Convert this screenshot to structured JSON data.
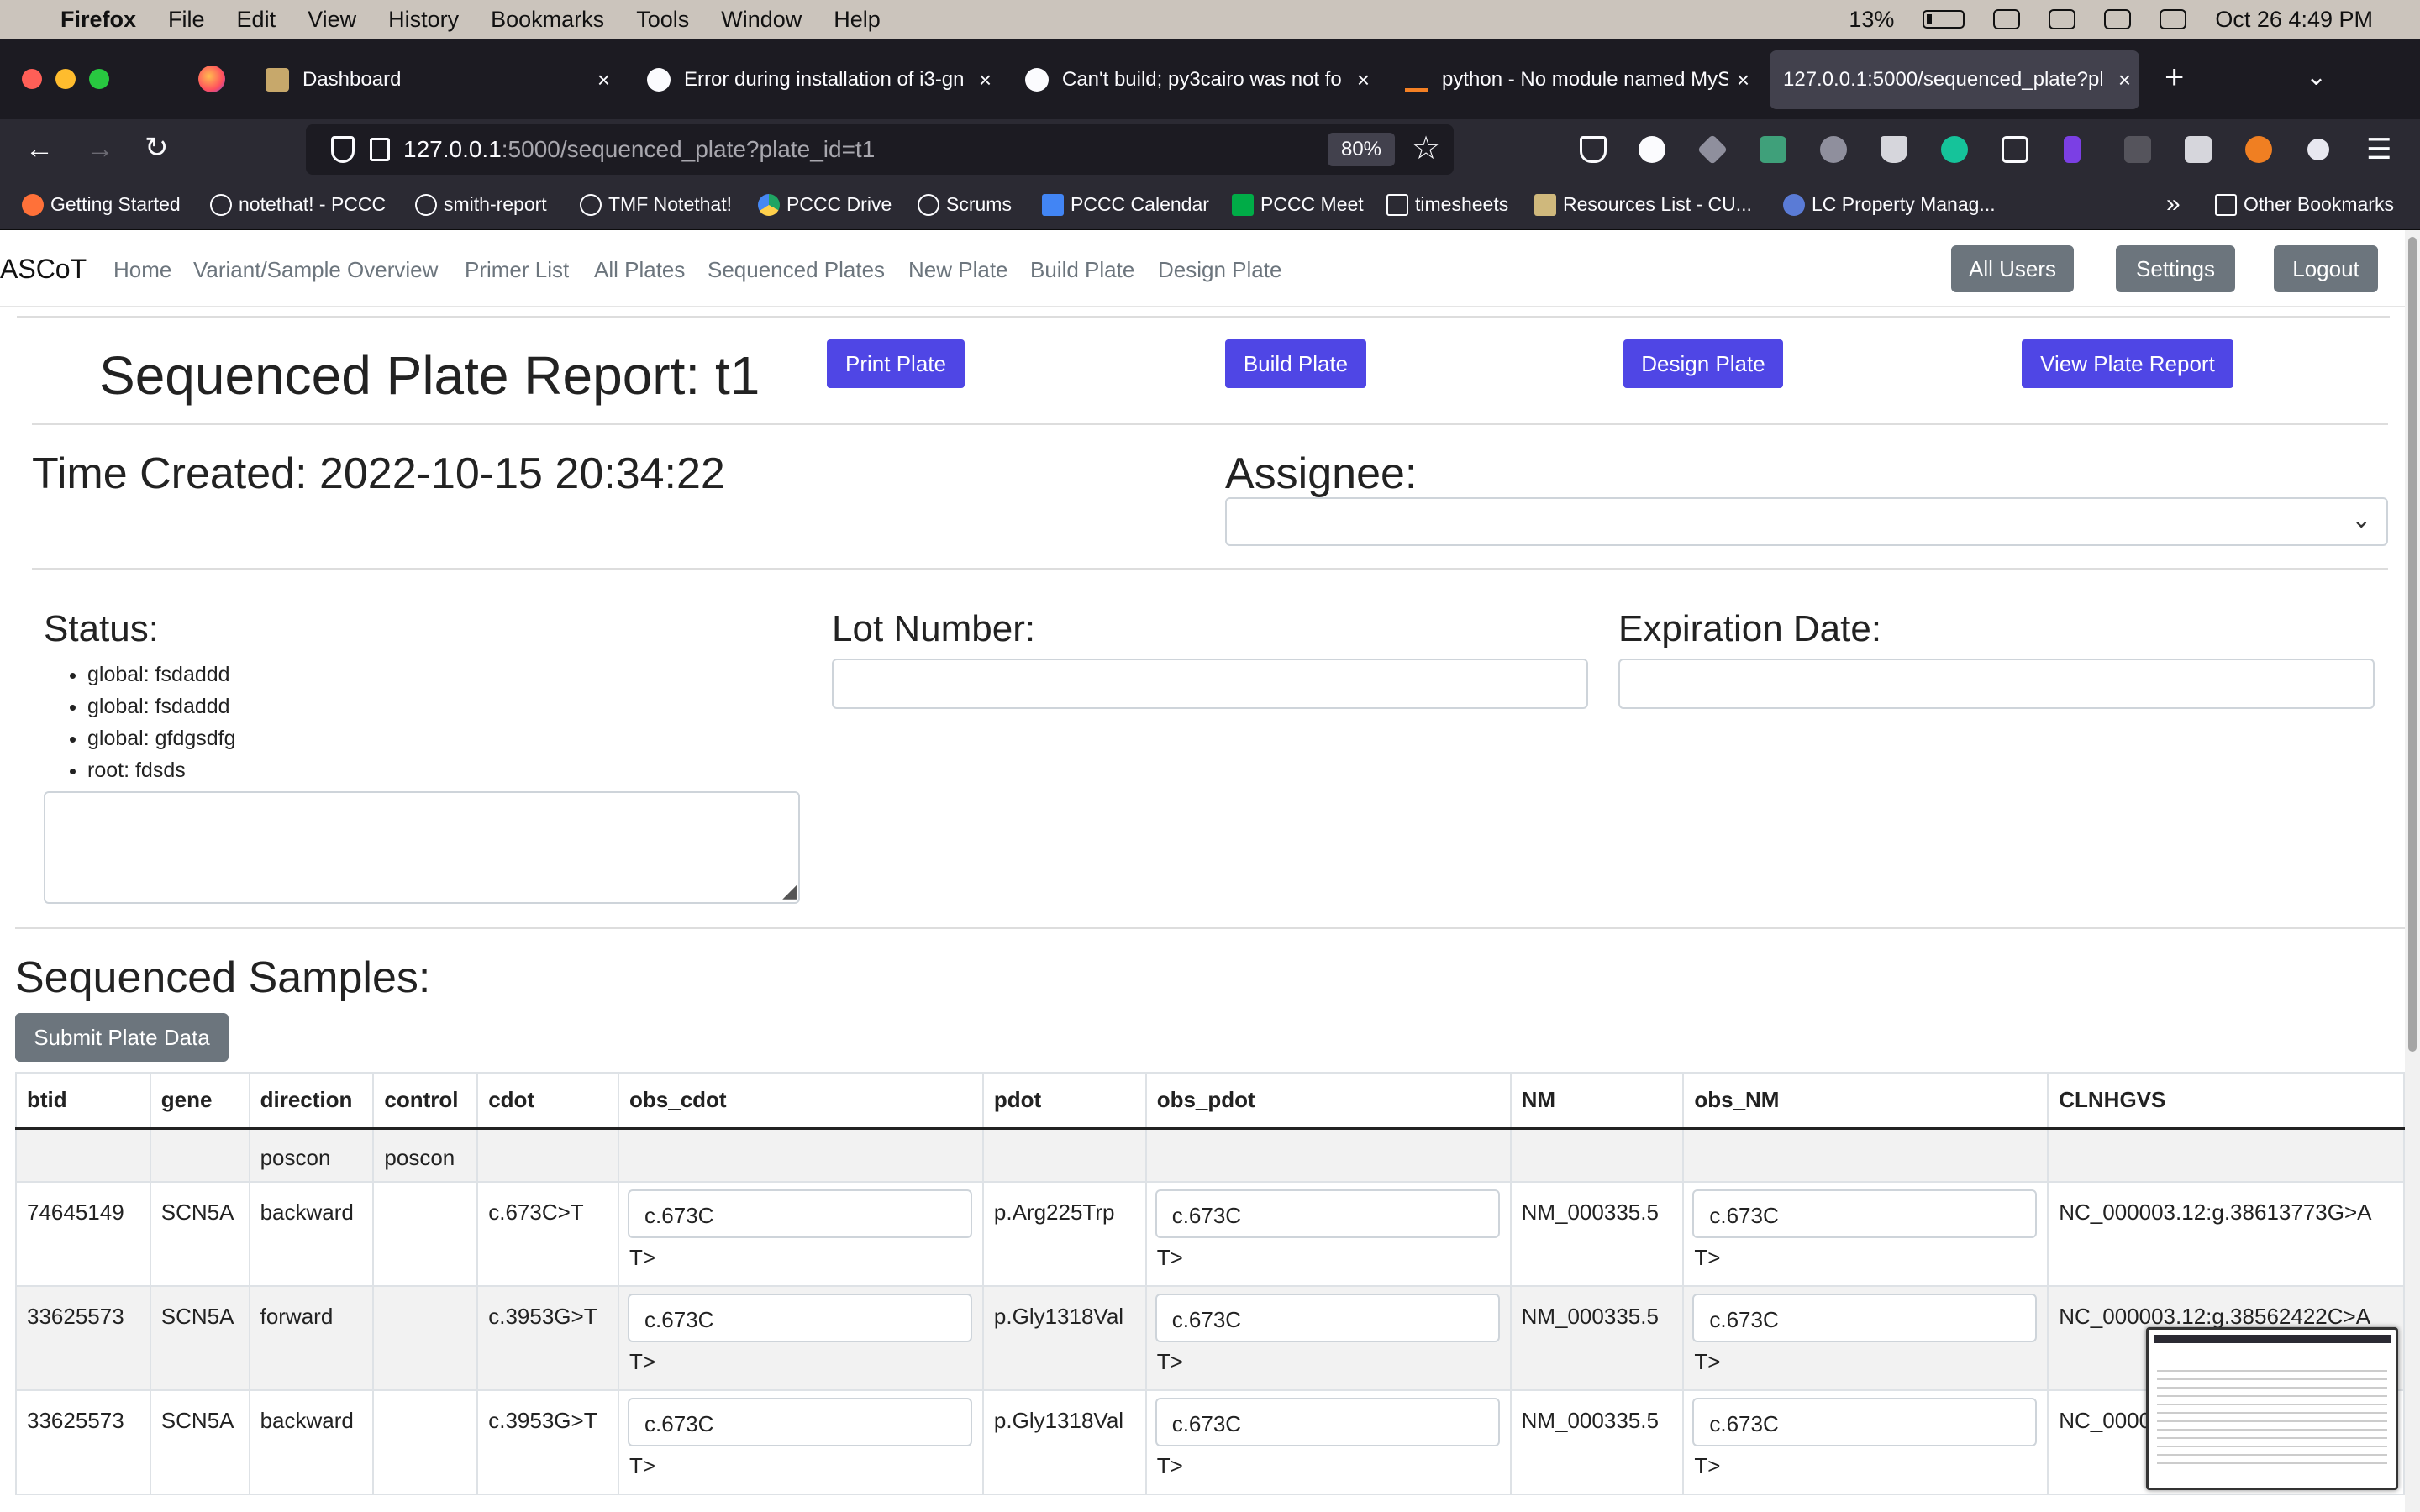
{
  "os_menubar": {
    "app": "Firefox",
    "menus": [
      "File",
      "Edit",
      "View",
      "History",
      "Bookmarks",
      "Tools",
      "Window",
      "Help"
    ],
    "battery": "13%",
    "datetime": "Oct 26  4:49 PM"
  },
  "browser": {
    "tabs": [
      {
        "label": "Dashboard",
        "active": false
      },
      {
        "label": "Error during installation of i3-gn",
        "active": false
      },
      {
        "label": "Can't build; py3cairo was not fo",
        "active": false
      },
      {
        "label": "python - No module named MyS",
        "active": false
      },
      {
        "label": "127.0.0.1:5000/sequenced_plate?pla",
        "active": true
      }
    ],
    "url_host": "127.0.0.1",
    "url_rest": ":5000/sequenced_plate?plate_id=t1",
    "zoom": "80%",
    "bookmarks": [
      "Getting Started",
      "notethat! - PCCC",
      "smith-report",
      "TMF Notethat!",
      "PCCC Drive",
      "Scrums",
      "PCCC Calendar",
      "PCCC Meet",
      "timesheets",
      "Resources List - CU...",
      "LC Property Manag...",
      "Other Bookmarks"
    ]
  },
  "app": {
    "brand": "ASCoT",
    "nav": [
      "Home",
      "Variant/Sample Overview",
      "Primer List",
      "All Plates",
      "Sequenced Plates",
      "New Plate",
      "Build Plate",
      "Design Plate"
    ],
    "right_buttons": [
      "All Users",
      "Settings",
      "Logout"
    ]
  },
  "report": {
    "title": "Sequenced Plate Report: t1",
    "actions": [
      "Print Plate",
      "Build Plate",
      "Design Plate",
      "View Plate Report"
    ],
    "time_created": "Time Created: 2022-10-15 20:34:22",
    "assignee_label": "Assignee:",
    "status_label": "Status:",
    "status_items": [
      "global: fsdaddd",
      "global: fsdaddd",
      "global: gfdgsdfg",
      "root: fdsds"
    ],
    "lot_label": "Lot Number:",
    "expiration_label": "Expiration Date:"
  },
  "samples": {
    "heading": "Sequenced Samples:",
    "submit_label": "Submit Plate Data",
    "columns": [
      "btid",
      "gene",
      "direction",
      "control",
      "cdot",
      "obs_cdot",
      "pdot",
      "obs_pdot",
      "NM",
      "obs_NM",
      "CLNHGVS"
    ],
    "subheader": [
      "",
      "",
      "poscon",
      "poscon",
      "",
      "",
      "",
      "",
      "",
      "",
      ""
    ],
    "rows": [
      {
        "btid": "74645149",
        "gene": "SCN5A",
        "direction": "backward",
        "control": "",
        "cdot": "c.673C>T",
        "obs_cdot": "c.673C",
        "obs_cdot_extra": "T>",
        "pdot": "p.Arg225Trp",
        "obs_pdot": "c.673C",
        "obs_pdot_extra": "T>",
        "NM": "NM_000335.5",
        "obs_NM": "c.673C",
        "obs_NM_extra": "T>",
        "CLNHGVS": "NC_000003.12:g.38613773G>A"
      },
      {
        "btid": "33625573",
        "gene": "SCN5A",
        "direction": "forward",
        "control": "",
        "cdot": "c.3953G>T",
        "obs_cdot": "c.673C",
        "obs_cdot_extra": "T>",
        "pdot": "p.Gly1318Val",
        "obs_pdot": "c.673C",
        "obs_pdot_extra": "T>",
        "NM": "NM_000335.5",
        "obs_NM": "c.673C",
        "obs_NM_extra": "T>",
        "CLNHGVS": "NC_000003.12:g.38562422C>A"
      },
      {
        "btid": "33625573",
        "gene": "SCN5A",
        "direction": "backward",
        "control": "",
        "cdot": "c.3953G>T",
        "obs_cdot": "c.673C",
        "obs_cdot_extra": "T>",
        "pdot": "p.Gly1318Val",
        "obs_pdot": "c.673C",
        "obs_pdot_extra": "T>",
        "NM": "NM_000335.5",
        "obs_NM": "c.673C",
        "obs_NM_extra": "T>",
        "CLNHGVS": "NC_0000"
      }
    ]
  },
  "colors": {
    "primary": "#4f46e5",
    "secondary": "#6c757d",
    "chrome": "#1c1b22"
  }
}
